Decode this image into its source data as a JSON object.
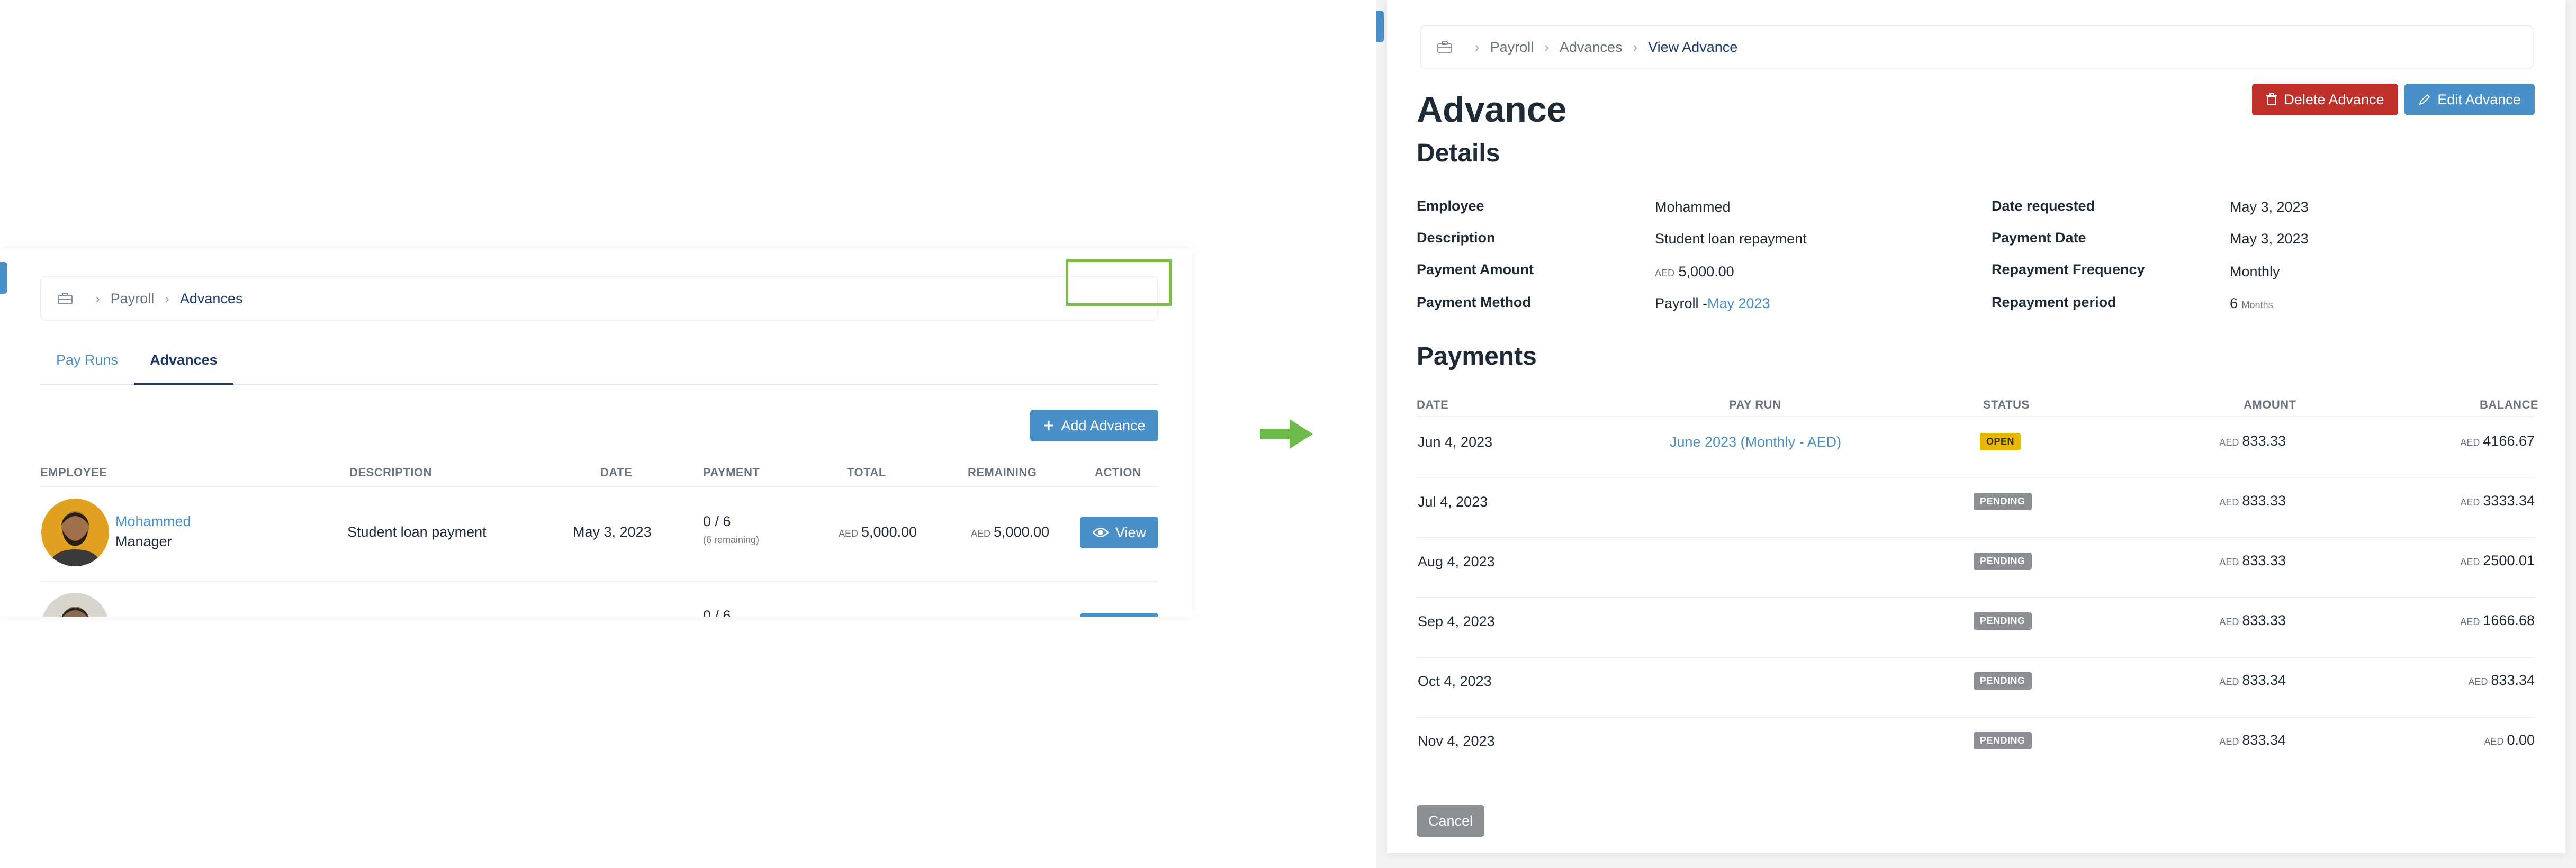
{
  "left": {
    "breadcrumb": [
      "Payroll",
      "Advances"
    ],
    "tabs": [
      {
        "label": "Pay Runs",
        "active": false
      },
      {
        "label": "Advances",
        "active": true
      }
    ],
    "add_button": "Add Advance",
    "table": {
      "headers": [
        "EMPLOYEE",
        "DESCRIPTION",
        "DATE",
        "PAYMENT",
        "TOTAL",
        "REMAINING",
        "ACTION"
      ],
      "rows": [
        {
          "name": "Mohammed",
          "role": "Manager",
          "description": "Student loan payment",
          "date": "May 3, 2023",
          "payment": "0 / 6",
          "payment_note": "(6 remaining)",
          "total_currency": "AED",
          "total": "5,000.00",
          "remaining_currency": "AED",
          "remaining": "5,000.00",
          "action": "View"
        }
      ],
      "partial_row": {
        "payment": "0 / 6"
      }
    }
  },
  "right": {
    "breadcrumb": [
      "Payroll",
      "Advances",
      "View Advance"
    ],
    "delete_button": "Delete Advance",
    "edit_button": "Edit Advance",
    "title": "Advance",
    "details_heading": "Details",
    "details": {
      "employee_label": "Employee",
      "employee": "Mohammed",
      "description_label": "Description",
      "description": "Student loan repayment",
      "amount_label": "Payment Amount",
      "amount_currency": "AED",
      "amount": "5,000.00",
      "method_label": "Payment Method",
      "method_prefix": "Payroll -",
      "method_link": "May 2023",
      "date_requested_label": "Date requested",
      "date_requested": "May 3, 2023",
      "payment_date_label": "Payment Date",
      "payment_date": "May 3, 2023",
      "frequency_label": "Repayment Frequency",
      "frequency": "Monthly",
      "period_label": "Repayment period",
      "period": "6",
      "period_unit": "Months"
    },
    "payments_heading": "Payments",
    "payments": {
      "headers": [
        "DATE",
        "PAY RUN",
        "STATUS",
        "AMOUNT",
        "BALANCE"
      ],
      "rows": [
        {
          "date": "Jun 4, 2023",
          "pay_run": "June 2023 (Monthly - AED)",
          "status": "OPEN",
          "amount": "833.33",
          "balance": "4166.67"
        },
        {
          "date": "Jul 4, 2023",
          "pay_run": "",
          "status": "PENDING",
          "amount": "833.33",
          "balance": "3333.34"
        },
        {
          "date": "Aug 4, 2023",
          "pay_run": "",
          "status": "PENDING",
          "amount": "833.33",
          "balance": "2500.01"
        },
        {
          "date": "Sep 4, 2023",
          "pay_run": "",
          "status": "PENDING",
          "amount": "833.33",
          "balance": "1666.68"
        },
        {
          "date": "Oct 4, 2023",
          "pay_run": "",
          "status": "PENDING",
          "amount": "833.34",
          "balance": "833.34"
        },
        {
          "date": "Nov 4, 2023",
          "pay_run": "",
          "status": "PENDING",
          "amount": "833.34",
          "balance": "0.00"
        }
      ],
      "currency": "AED"
    },
    "cancel_button": "Cancel"
  },
  "colors": {
    "primary": "#4a90c8",
    "navy": "#1e3a6e",
    "danger": "#c0302b",
    "open": "#e6b800",
    "pending": "#8b8f94",
    "highlight": "#7bc043",
    "arrow": "#6dbb4a"
  }
}
